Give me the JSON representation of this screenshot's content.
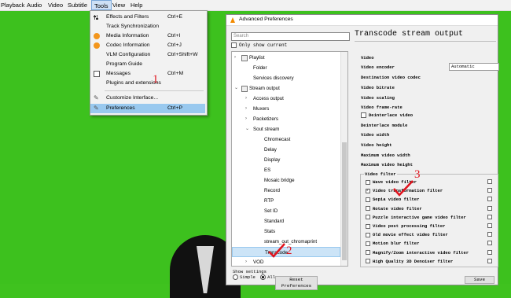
{
  "menubar": [
    "Playback",
    "Audio",
    "Video",
    "Subtitle",
    "Tools",
    "View",
    "Help"
  ],
  "tools_menu": [
    {
      "label": "Effects and Filters",
      "shortcut": "Ctrl+E",
      "icon": "sliders-icon"
    },
    {
      "label": "Track Synchronization",
      "shortcut": "",
      "icon": ""
    },
    {
      "label": "Media Information",
      "shortcut": "Ctrl+I",
      "icon": "info-icon"
    },
    {
      "label": "Codec Information",
      "shortcut": "Ctrl+J",
      "icon": "info-icon"
    },
    {
      "label": "VLM Configuration",
      "shortcut": "Ctrl+Shift+W",
      "icon": ""
    },
    {
      "label": "Program Guide",
      "shortcut": "",
      "icon": ""
    },
    {
      "label": "Messages",
      "shortcut": "Ctrl+M",
      "icon": "messages-icon"
    },
    {
      "label": "Plugins and extensions",
      "shortcut": "",
      "icon": ""
    },
    {
      "label": "Customize Interface...",
      "shortcut": "",
      "icon": "wrench-icon"
    },
    {
      "label": "Preferences",
      "shortcut": "Ctrl+P",
      "icon": "wrench-icon",
      "selected": true
    }
  ],
  "window": {
    "title": "Advanced Preferences"
  },
  "search": {
    "placeholder": "Search"
  },
  "only_show_current": "Only show current",
  "tree": [
    {
      "label": "Playlist",
      "level": 0,
      "expander": ">"
    },
    {
      "label": "Folder",
      "level": 1,
      "expander": ""
    },
    {
      "label": "Services discovery",
      "level": 1,
      "expander": ""
    },
    {
      "label": "Stream output",
      "level": 0,
      "expander": "v"
    },
    {
      "label": "Access output",
      "level": 1,
      "expander": ">"
    },
    {
      "label": "Muxers",
      "level": 1,
      "expander": ">"
    },
    {
      "label": "Packetizers",
      "level": 1,
      "expander": ">"
    },
    {
      "label": "Sout stream",
      "level": 1,
      "expander": "v"
    },
    {
      "label": "Chromecast",
      "level": 2,
      "expander": ""
    },
    {
      "label": "Delay",
      "level": 2,
      "expander": ""
    },
    {
      "label": "Display",
      "level": 2,
      "expander": ""
    },
    {
      "label": "ES",
      "level": 2,
      "expander": ""
    },
    {
      "label": "Mosaic bridge",
      "level": 2,
      "expander": ""
    },
    {
      "label": "Record",
      "level": 2,
      "expander": ""
    },
    {
      "label": "RTP",
      "level": 2,
      "expander": ""
    },
    {
      "label": "Set ID",
      "level": 2,
      "expander": ""
    },
    {
      "label": "Standard",
      "level": 2,
      "expander": ""
    },
    {
      "label": "Stats",
      "level": 2,
      "expander": ""
    },
    {
      "label": "stream_out_chromaprint",
      "level": 2,
      "expander": ""
    },
    {
      "label": "Transcode",
      "level": 2,
      "expander": "",
      "selected": true
    },
    {
      "label": "VOD",
      "level": 1,
      "expander": ">"
    }
  ],
  "show_settings": {
    "label": "Show settings",
    "simple": "Simple",
    "all": "All"
  },
  "buttons": {
    "reset": "Reset Preferences",
    "save": "Save"
  },
  "panel": {
    "title": "Transcode stream output",
    "fields": [
      "Video",
      "Video encoder",
      "Destination video codec",
      "Video bitrate",
      "Video scaling",
      "Video frame-rate",
      "Deinterlace video",
      "Deinterlace module",
      "Video width",
      "Video height",
      "Maximum video width",
      "Maximum video height"
    ],
    "encoder_value": "Automatic",
    "video_filter_title": "Video filter",
    "filters": [
      {
        "label": "Wave video filter",
        "checked": false
      },
      {
        "label": "Video transformation filter",
        "checked": true
      },
      {
        "label": "Sepia video filter",
        "checked": false
      },
      {
        "label": "Rotate video filter",
        "checked": false
      },
      {
        "label": "Puzzle interactive game video filter",
        "checked": false
      },
      {
        "label": "Video post processing filter",
        "checked": false
      },
      {
        "label": "Old movie effect video filter",
        "checked": false
      },
      {
        "label": "Motion blur filter",
        "checked": false
      },
      {
        "label": "Magnify/Zoom interactive video filter",
        "checked": false
      },
      {
        "label": "High Quality 3D Denoiser filter",
        "checked": false
      }
    ]
  },
  "annotations": [
    "1",
    "2",
    "3"
  ],
  "colors": {
    "vlc_orange": "#f28a00",
    "selection": "#99c9ef",
    "annotation_red": "#e0141e",
    "green_screen": "#3dc11e"
  }
}
